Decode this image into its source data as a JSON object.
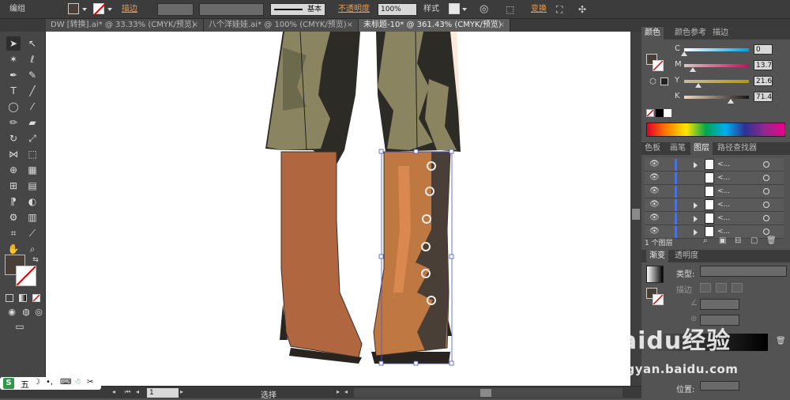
{
  "control_bar": {
    "group_label": "编组",
    "stroke_label": "描边",
    "stroke_profile": "基本",
    "opacity_label": "不透明度",
    "opacity_value": "100%",
    "style_label": "样式",
    "transform_label": "变换"
  },
  "doc_tabs": [
    {
      "label": "DW [转换].ai* @ 33.33% (CMYK/预览)",
      "active": false
    },
    {
      "label": "八个洋娃娃.ai* @ 100% (CMYK/预览)",
      "active": false
    },
    {
      "label": "未标题-10* @ 361.43% (CMYK/预览)",
      "active": true
    }
  ],
  "color_panel": {
    "tabs": [
      "颜色",
      "颜色参考",
      "描边"
    ],
    "channels": [
      {
        "label": "C",
        "value": "0",
        "fraction": 0.0
      },
      {
        "label": "M",
        "value": "13.7",
        "fraction": 0.137
      },
      {
        "label": "Y",
        "value": "21.6",
        "fraction": 0.216
      },
      {
        "label": "K",
        "value": "71.4",
        "fraction": 0.714
      }
    ]
  },
  "layers_panel": {
    "tabs": [
      "色板",
      "画笔",
      "图层",
      "路径查找器"
    ],
    "rows": [
      {
        "name": "<...",
        "expandable": true
      },
      {
        "name": "<...",
        "expandable": false
      },
      {
        "name": "<...",
        "expandable": false
      },
      {
        "name": "<...",
        "expandable": true
      },
      {
        "name": "<...",
        "expandable": true
      },
      {
        "name": "<...",
        "expandable": true
      }
    ],
    "footer": "1 个图层"
  },
  "gradient_panel": {
    "tabs": [
      "渐变",
      "透明度"
    ],
    "type_label": "类型:",
    "stroke_label": "描边",
    "position_label": "位置:"
  },
  "status_bar": {
    "zoom": "1",
    "selection_label": "选择"
  },
  "watermark": {
    "brand": "Baidu经验",
    "url": "jingyan.baidu.com"
  },
  "ime": {
    "label": "五"
  },
  "colors": {
    "fill": "#4a3f36",
    "pants": "#8b8461",
    "pants_dark": "#2d2b26",
    "boot": "#b0673f",
    "boot_dark": "#3a2f2a",
    "selection": "#4455cc"
  }
}
